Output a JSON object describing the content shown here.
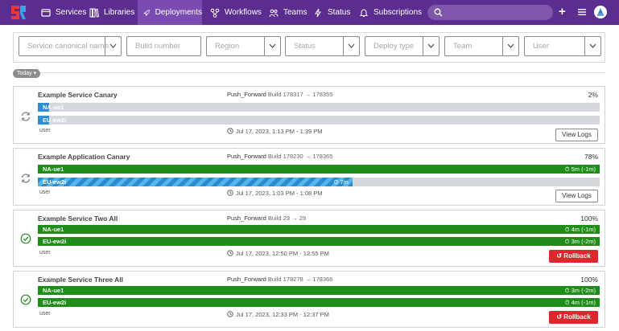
{
  "nav": {
    "items": [
      {
        "label": "Services",
        "icon": "window-icon"
      },
      {
        "label": "Libraries",
        "icon": "books-icon"
      },
      {
        "label": "Deployments",
        "icon": "rocket-icon"
      },
      {
        "label": "Workflows",
        "icon": "workflow-icon"
      },
      {
        "label": "Teams",
        "icon": "people-icon"
      },
      {
        "label": "Status",
        "icon": "bolt-icon"
      },
      {
        "label": "Subscriptions",
        "icon": "bell-icon"
      }
    ],
    "active": "Deployments",
    "plus": "+",
    "colors": {
      "bar": "#5b2d8e",
      "active": "#7a4bb0",
      "search": "#7e56aa"
    }
  },
  "filters": {
    "service": "Service canonical name",
    "build": "Build number",
    "region": "Region",
    "status": "Status",
    "deploy_type": "Deploy type",
    "team": "Team",
    "user": "User"
  },
  "group_label": "Today ▾",
  "deployments": [
    {
      "title": "Example Service Canary",
      "mode": "Push_Forward",
      "build_word": "Build",
      "from": "178317",
      "arrow": "→",
      "to": "178355",
      "percent": "2%",
      "status_icon": "sync-icon",
      "regions": [
        {
          "name": "NA-ue1",
          "progress": 0.02,
          "time": "",
          "color": "blue"
        },
        {
          "name": "EU-ew2i",
          "progress": 0.02,
          "time": "",
          "color": "blue"
        }
      ],
      "user": "user",
      "when": "Jul 17, 2023, 1:13 PM - 1:39 PM",
      "action": "View Logs"
    },
    {
      "title": "Example Application Canary",
      "mode": "Push_Forward",
      "build_word": "Build",
      "from": "178230",
      "arrow": "→",
      "to": "178365",
      "percent": "78%",
      "status_icon": "sync-icon",
      "regions": [
        {
          "name": "NA-ue1",
          "progress": 1.0,
          "time": "5m (-1m)",
          "color": "green"
        },
        {
          "name": "EU-ew2i",
          "progress": 0.56,
          "time": "7m",
          "color": "striped"
        }
      ],
      "user": "user",
      "when": "Jul 17, 2023, 1:03 PM - 1:08 PM",
      "action": "View Logs"
    },
    {
      "title": "Example Service Two All",
      "mode": "Push_Forward",
      "build_word": "Build",
      "from": "29",
      "arrow": "→",
      "to": "29",
      "percent": "100%",
      "status_icon": "check-circle-icon",
      "regions": [
        {
          "name": "NA-ue1",
          "progress": 1.0,
          "time": "4m (-1m)",
          "color": "green"
        },
        {
          "name": "EU-ew2i",
          "progress": 1.0,
          "time": "3m (-2m)",
          "color": "green"
        }
      ],
      "user": "user",
      "when": "Jul 17, 2023, 12:50 PM - 12:55 PM",
      "action": "Rollback"
    },
    {
      "title": "Example Service Three All",
      "mode": "Push_Forward",
      "build_word": "Build",
      "from": "178278",
      "arrow": "→",
      "to": "178366",
      "percent": "100%",
      "status_icon": "check-circle-icon",
      "regions": [
        {
          "name": "NA-ue1",
          "progress": 1.0,
          "time": "3m (-2m)",
          "color": "green"
        },
        {
          "name": "EU-ew2i",
          "progress": 1.0,
          "time": "4m (-1m)",
          "color": "green"
        }
      ],
      "user": "user",
      "when": "Jul 17, 2023, 12:33 PM - 12:37 PM",
      "action": "Rollback"
    }
  ]
}
